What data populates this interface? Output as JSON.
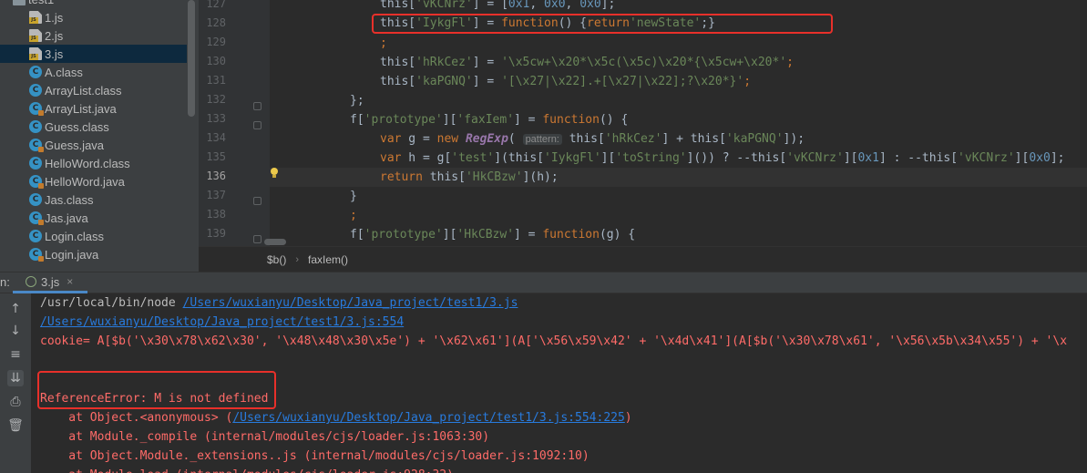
{
  "project_tree": {
    "partial_folder": "test1",
    "items": [
      {
        "label": "1.js",
        "icon": "js-file-icon",
        "type": "js"
      },
      {
        "label": "2.js",
        "icon": "js-file-icon",
        "type": "js"
      },
      {
        "label": "3.js",
        "icon": "js-file-icon",
        "type": "js",
        "selected": true
      },
      {
        "label": "A.class",
        "icon": "class-file-icon",
        "type": "class"
      },
      {
        "label": "ArrayList.class",
        "icon": "class-file-icon",
        "type": "class"
      },
      {
        "label": "ArrayList.java",
        "icon": "java-file-icon",
        "type": "java"
      },
      {
        "label": "Guess.class",
        "icon": "class-file-icon",
        "type": "class"
      },
      {
        "label": "Guess.java",
        "icon": "java-file-icon",
        "type": "java"
      },
      {
        "label": "HelloWord.class",
        "icon": "class-file-icon",
        "type": "class"
      },
      {
        "label": "HelloWord.java",
        "icon": "java-file-icon",
        "type": "java"
      },
      {
        "label": "Jas.class",
        "icon": "class-file-icon",
        "type": "class"
      },
      {
        "label": "Jas.java",
        "icon": "java-file-icon",
        "type": "java"
      },
      {
        "label": "Login.class",
        "icon": "class-file-icon",
        "type": "class"
      },
      {
        "label": "Login.java",
        "icon": "java-file-icon",
        "type": "java"
      }
    ]
  },
  "editor": {
    "line_numbers": [
      "127",
      "128",
      "129",
      "130",
      "131",
      "132",
      "133",
      "134",
      "135",
      "136",
      "137",
      "138",
      "139"
    ],
    "current_line": "136",
    "code": {
      "l127_a": "this[",
      "l127_b": "'vKCNrz'",
      "l127_c": "] = [",
      "l127_d": "0x1",
      "l127_e": ", ",
      "l127_f": "0x0",
      "l127_g": ", ",
      "l127_h": "0x0",
      "l127_i": "];",
      "l128_a": "this[",
      "l128_b": "'IykgFl'",
      "l128_c": "] = ",
      "l128_d": "function",
      "l128_e": "() {",
      "l128_f": "return",
      "l128_g": "'newState'",
      "l128_h": ";}",
      "l129": ";",
      "l130_a": "this[",
      "l130_b": "'hRkCez'",
      "l130_c": "] = ",
      "l130_d": "'\\x5cw+\\x20*\\x5c(\\x5c)\\x20*{\\x5cw+\\x20*'",
      "l130_e": ";",
      "l131_a": "this[",
      "l131_b": "'kaPGNQ'",
      "l131_c": "] = ",
      "l131_d": "'[\\x27|\\x22].+[\\x27|\\x22];?\\x20*}'",
      "l131_e": ";",
      "l132": "};",
      "l133_a": "f[",
      "l133_b": "'prototype'",
      "l133_c": "][",
      "l133_d": "'faxIem'",
      "l133_e": "] = ",
      "l133_f": "function",
      "l133_g": "() {",
      "l134_a": "var",
      "l134_b": " g = ",
      "l134_c": "new ",
      "l134_d": "RegExp",
      "l134_e": "( ",
      "l134_hint": "pattern:",
      "l134_f": " this[",
      "l134_g": "'hRkCez'",
      "l134_h": "] + this[",
      "l134_i": "'kaPGNQ'",
      "l134_j": "]);",
      "l135_a": "var",
      "l135_b": " h = g[",
      "l135_c": "'test'",
      "l135_d": "](this[",
      "l135_e": "'IykgFl'",
      "l135_f": "][",
      "l135_g": "'toString'",
      "l135_h": "]()) ? --this[",
      "l135_i": "'vKCNrz'",
      "l135_j": "][",
      "l135_k": "0x1",
      "l135_l": "] : --this[",
      "l135_m": "'vKCNrz'",
      "l135_n": "][",
      "l135_o": "0x0",
      "l135_p": "];",
      "l136_a": "return",
      "l136_b": " this[",
      "l136_c": "'HkCBzw'",
      "l136_d": "](h);",
      "l137": "}",
      "l138": ";",
      "l139_a": "f[",
      "l139_b": "'prototype'",
      "l139_c": "][",
      "l139_d": "'HkCBzw'",
      "l139_e": "] = ",
      "l139_f": "function",
      "l139_g": "(g) {"
    },
    "breadcrumb": [
      "$b()",
      "faxIem()"
    ]
  },
  "run_panel": {
    "label": "n:",
    "tab_label": "3.js",
    "tab_close": "×",
    "toolbar_icons": [
      "arrow-up-icon",
      "arrow-down-icon",
      "soft-wrap-icon",
      "scroll-to-end-icon",
      "print-icon",
      "trash-icon"
    ],
    "console": {
      "line1_cmd": "/usr/local/bin/node ",
      "line1_link": "/Users/wuxianyu/Desktop/Java_project/test1/3.js",
      "line2_link": "/Users/wuxianyu/Desktop/Java_project/test1/3.js:554",
      "line3": "cookie= A[$b('\\x30\\x78\\x62\\x30', '\\x48\\x48\\x30\\x5e') + '\\x62\\x61'](A['\\x56\\x59\\x42' + '\\x4d\\x41'](A[$b('\\x30\\x78\\x61', '\\x56\\x5b\\x34\\x55') + '\\x",
      "line5": "ReferenceError: M is not defined",
      "line6_a": "    at Object.<anonymous> (",
      "line6_link": "/Users/wuxianyu/Desktop/Java_project/test1/3.js:554:225",
      "line6_b": ")",
      "line7": "    at Module._compile (internal/modules/cjs/loader.js:1063:30)",
      "line8": "    at Object.Module._extensions..js (internal/modules/cjs/loader.js:1092:10)",
      "line9": "    at Module.load (internal/modules/cjs/loader.js:928:32)"
    }
  },
  "colors": {
    "highlight_box": "#e8302a",
    "error_text": "#ff6b68",
    "link": "#287bde"
  }
}
